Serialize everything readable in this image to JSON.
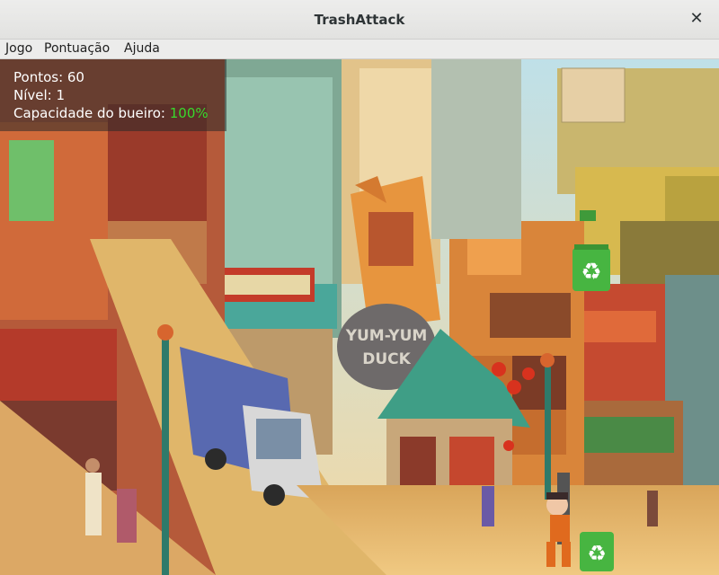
{
  "window": {
    "title": "TrashAttack",
    "close_icon": "close-icon"
  },
  "menu": {
    "items": [
      "Jogo",
      "Pontuação",
      "Ajuda"
    ]
  },
  "hud": {
    "score_label": "Pontos: 60",
    "level_label": "Nível: 1",
    "capacity_label": "Capacidade do bueiro: ",
    "capacity_value": "100%",
    "capacity_color": "#39d92c"
  },
  "scene": {
    "sign_text": [
      "YUM-YUM",
      "DUCK"
    ],
    "recycle_icon": "recycle-icon",
    "player": "player-character"
  }
}
